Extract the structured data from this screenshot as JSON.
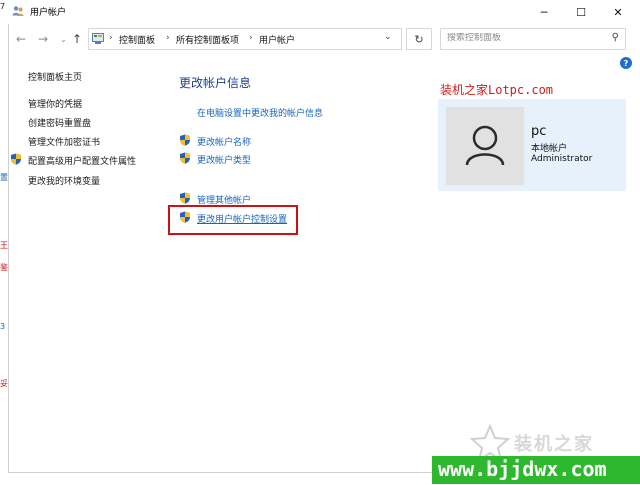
{
  "window": {
    "title": "用户帐户",
    "controls": {
      "minimize": "─",
      "maximize": "☐",
      "close": "✕"
    }
  },
  "nav": {
    "back": "←",
    "forward": "→",
    "recent": "⌄",
    "up": "↑",
    "breadcrumbs": [
      "控制面板",
      "所有控制面板项",
      "用户帐户"
    ],
    "separator": "›",
    "dropdown": "⌄",
    "refresh": "↻"
  },
  "search": {
    "placeholder": "搜索控制面板",
    "icon": "search-icon"
  },
  "help": {
    "label": "?"
  },
  "sidebar": {
    "items": [
      {
        "label": "控制面板主页"
      },
      {
        "label": "管理你的凭据"
      },
      {
        "label": "创建密码重置盘"
      },
      {
        "label": "管理文件加密证书"
      },
      {
        "label": "配置高级用户配置文件属性",
        "icon": "shield-icon"
      },
      {
        "label": "更改我的环境变量"
      }
    ]
  },
  "main": {
    "title": "更改帐户信息",
    "links": [
      {
        "label": "在电脑设置中更改我的帐户信息",
        "shield": false
      },
      {
        "label": "更改帐户名称",
        "shield": true
      },
      {
        "label": "更改帐户类型",
        "shield": true
      },
      {
        "label": "管理其他帐户",
        "shield": true
      },
      {
        "label": "更改用户帐户控制设置",
        "shield": true,
        "highlighted": true
      }
    ]
  },
  "account": {
    "name": "pc",
    "type": "本地帐户",
    "role": "Administrator"
  },
  "watermarks": {
    "top": "装机之家Lotpc.com",
    "brand": "装机之家",
    "url": "www.bjjdwx.com"
  },
  "left_strip": [
    "7",
    "置",
    "王",
    "鉴",
    "3",
    "妥"
  ],
  "colors": {
    "link": "#1565c0",
    "title": "#1c3f94",
    "highlight": "#c81414",
    "card": "#e6f1fb",
    "watermark": "#d21a1a",
    "url_bg": "#2db82d"
  }
}
